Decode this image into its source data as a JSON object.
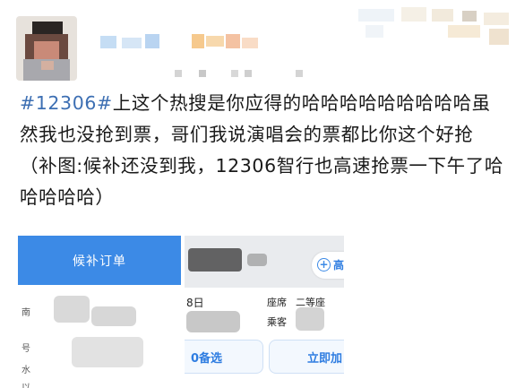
{
  "post": {
    "hashtag": "#12306#",
    "body": "上这个热搜是你应得的哈哈哈哈哈哈哈哈哈虽然我也没抢到票，哥们我说演唱会的票都比你这个好抢 （补图:候补还没到我，12306智行也高速抢票一下午了哈哈哈哈哈）"
  },
  "left_screenshot": {
    "header": "候补订单",
    "labels": [
      "南",
      "号",
      "水",
      "以"
    ]
  },
  "right_screenshot": {
    "top_partial": "高",
    "date_fragment": "8日",
    "seat_label": "座席",
    "seat_value": "二等座",
    "passenger_label": "乘客",
    "button_left": "0备选",
    "button_right": "立即加"
  },
  "colors": {
    "hashtag": "#3d6fb3",
    "header_blue": "#3c8ae6",
    "button_blue": "#2f7de1"
  }
}
